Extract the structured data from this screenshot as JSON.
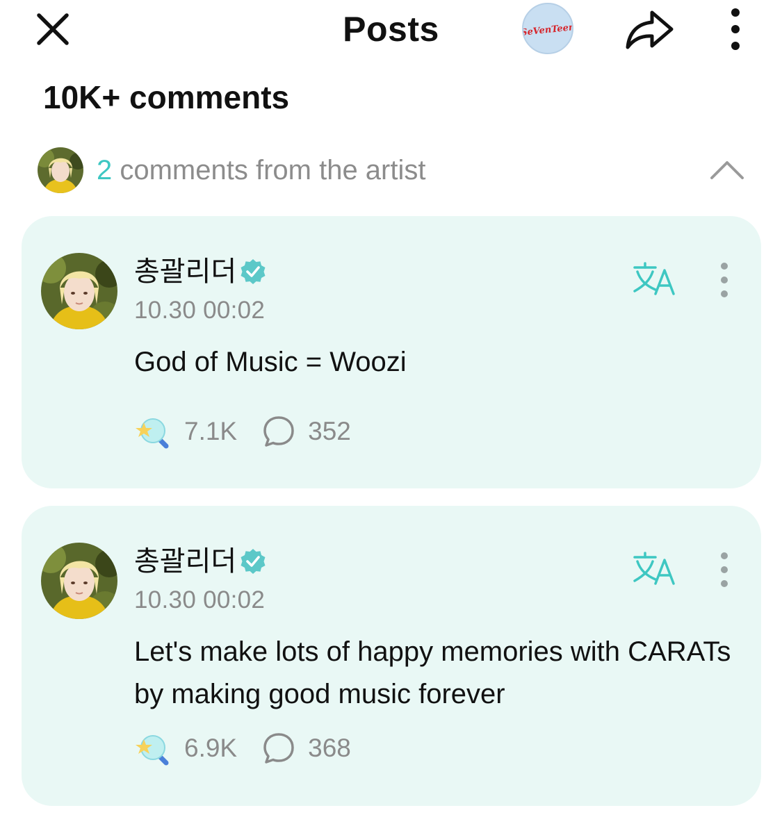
{
  "header": {
    "title": "Posts",
    "close_icon": "close-icon",
    "community_logo": "seventeen-logo",
    "community_logo_text": "SeVenTeen",
    "share_icon": "share-icon",
    "more_icon": "more-vertical-icon"
  },
  "comments_summary": {
    "label": "10K+ comments"
  },
  "artist_comments": {
    "count": "2",
    "label": " comments from the artist",
    "expanded": true,
    "chevron_icon": "chevron-up-icon"
  },
  "comments": [
    {
      "author": "총괄리더",
      "verified": true,
      "timestamp": "10.30 00:02",
      "text": "God of Music = Woozi",
      "likes": "7.1K",
      "replies": "352"
    },
    {
      "author": "총괄리더",
      "verified": true,
      "timestamp": "10.30 00:02",
      "text": "Let's make lots of happy memories with CARATs by making good music forever",
      "likes": "6.9K",
      "replies": "368"
    }
  ],
  "colors": {
    "accent": "#3ec7c2",
    "card_background": "#e9f8f5",
    "muted_text": "#8a8a8a",
    "verified_badge": "#5cc8c8"
  }
}
